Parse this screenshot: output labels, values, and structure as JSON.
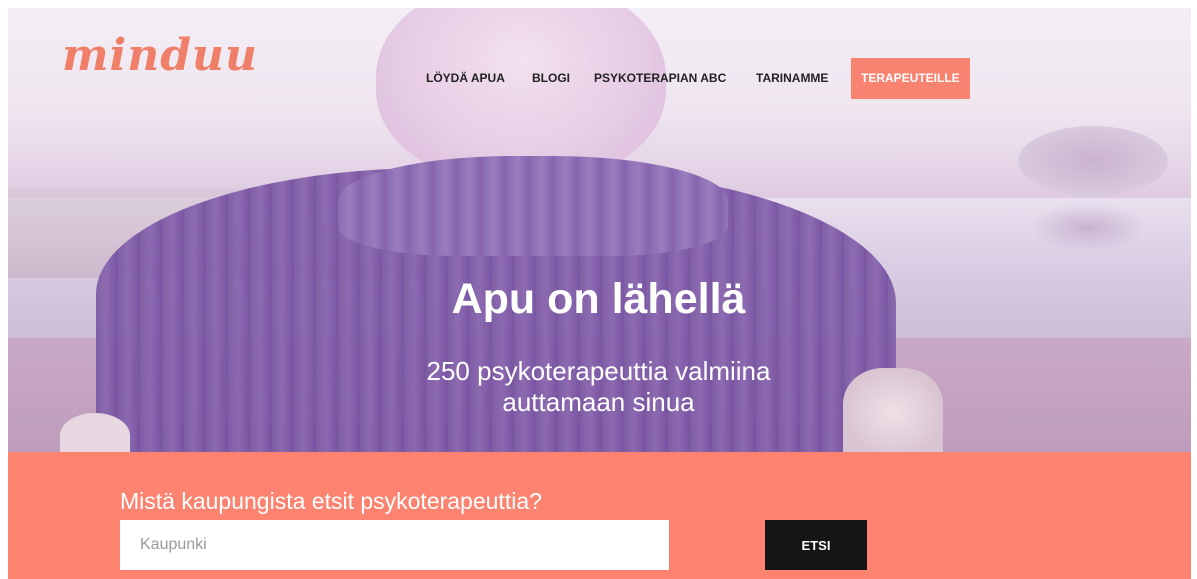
{
  "brand": {
    "logo_text": "minduu"
  },
  "nav": {
    "items": [
      {
        "label": "LÖYDÄ APUA"
      },
      {
        "label": "BLOGI"
      },
      {
        "label": "PSYKOTERAPIAN ABC"
      },
      {
        "label": "TARINAMME"
      }
    ],
    "cta_label": "TERAPEUTEILLE"
  },
  "hero": {
    "title": "Apu on lähellä",
    "subtitle_line1": "250 psykoterapeuttia valmiina",
    "subtitle_line2": "auttamaan sinua"
  },
  "search": {
    "question": "Mistä kaupungista etsit psykoterapeuttia?",
    "placeholder": "Kaupunki",
    "value": "",
    "button_label": "ETSI"
  },
  "colors": {
    "accent": "#fc8370",
    "button_dark": "#151515",
    "logo": "#f07f69"
  }
}
